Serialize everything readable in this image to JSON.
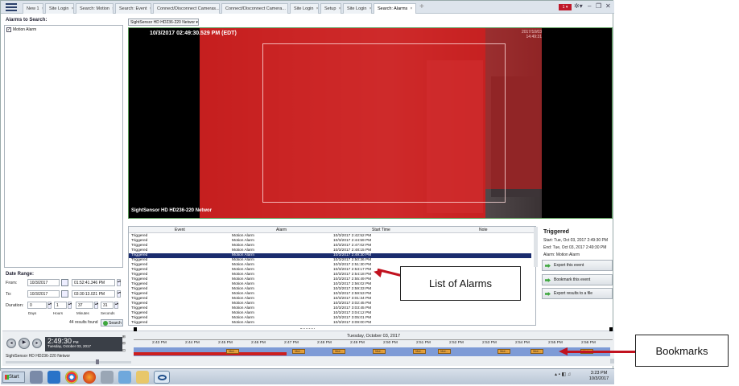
{
  "app": {
    "tabs": [
      "New 1",
      "Site Login",
      "Search: Motion",
      "Search: Event",
      "Connect/Disconnect Cameras...",
      "Connect/Disconnect Camera...",
      "Site Login",
      "Setup",
      "Site Login",
      "Search: Alarms"
    ],
    "active_tab": "Search: Alarms",
    "badge": "1"
  },
  "left": {
    "alarms_title": "Alarms to Search:",
    "alarm_item": "Motion Alarm",
    "date_range_title": "Date Range:",
    "from_label": "From:",
    "from_date": "10/3/2017",
    "from_time": "01:52:41.346 PM",
    "to_label": "To:",
    "to_date": "10/3/2017",
    "to_time": "03:30:13.021 PM",
    "duration_label": "Duration:",
    "dur_days": "0",
    "dur_hours": "1",
    "dur_minutes": "37",
    "dur_seconds": "31",
    "days": "Days",
    "hours": "Hours",
    "minutes": "Minutes",
    "seconds": "Seconds",
    "results": "44 results found",
    "search": "Search"
  },
  "camera": {
    "selector": "SightSensor HD HD236-220 Networ",
    "overlay_datetime": "10/3/2017 02:49:30.529 PM (EDT)",
    "corner_text": "2017/10/03 14:49:31",
    "name_overlay": "SightSensor HD HD236-220 Networ"
  },
  "list": {
    "headers": [
      "Event",
      "Alarm",
      "Start Time",
      "Note"
    ],
    "rows": [
      [
        "Triggered",
        "Motion Alarm",
        "10/3/2017 2:42:52 PM"
      ],
      [
        "Triggered",
        "Motion Alarm",
        "10/3/2017 2:44:59 PM"
      ],
      [
        "Triggered",
        "Motion Alarm",
        "10/3/2017 2:47:02 PM"
      ],
      [
        "Triggered",
        "Motion Alarm",
        "10/3/2017 2:48:15 PM"
      ],
      [
        "Triggered",
        "Motion Alarm",
        "10/3/2017 2:49:30 PM"
      ],
      [
        "Triggered",
        "Motion Alarm",
        "10/3/2017 2:50:36 PM"
      ],
      [
        "Triggered",
        "Motion Alarm",
        "10/3/2017 2:51:30 PM"
      ],
      [
        "Triggered",
        "Motion Alarm",
        "10/3/2017 2:53:17 PM"
      ],
      [
        "Triggered",
        "Motion Alarm",
        "10/3/2017 2:54:18 PM"
      ],
      [
        "Triggered",
        "Motion Alarm",
        "10/3/2017 2:55:49 PM"
      ],
      [
        "Triggered",
        "Motion Alarm",
        "10/3/2017 2:56:02 PM"
      ],
      [
        "Triggered",
        "Motion Alarm",
        "10/3/2017 2:59:33 PM"
      ],
      [
        "Triggered",
        "Motion Alarm",
        "10/3/2017 2:59:53 PM"
      ],
      [
        "Triggered",
        "Motion Alarm",
        "10/3/2017 3:01:34 PM"
      ],
      [
        "Triggered",
        "Motion Alarm",
        "10/3/2017 3:02:45 PM"
      ],
      [
        "Triggered",
        "Motion Alarm",
        "10/3/2017 3:03:45 PM"
      ],
      [
        "Triggered",
        "Motion Alarm",
        "10/3/2017 3:04:12 PM"
      ],
      [
        "Triggered",
        "Motion Alarm",
        "10/3/2017 3:05:01 PM"
      ],
      [
        "Triggered",
        "Motion Alarm",
        "10/3/2017 3:09:00 PM"
      ]
    ],
    "selected_index": 4
  },
  "details": {
    "title": "Triggered",
    "start": "Start:  Tue, Oct 03, 2017 2:49:30 PM",
    "end": "End:   Tue, Oct 03, 2017 2:49:30 PM",
    "alarm": "Alarm: Motion Alarm",
    "export_event": "Export this event",
    "bookmark": "Bookmark this event",
    "export_results": "Export results to a file"
  },
  "callouts": {
    "list": "List of Alarms",
    "bookmarks": "Bookmarks"
  },
  "player": {
    "time": "2:49:30",
    "ampm": "PM",
    "date": "Tuesday, October 03, 2017",
    "camera": "SightSensor HD HD236-220 Networ"
  },
  "timeline": {
    "date": "Tuesday, October 03, 2017",
    "ticks": [
      "2:43 PM",
      "2:44 PM",
      "2:45 PM",
      "2:46 PM",
      "2:47 PM",
      "2:48 PM",
      "2:49 PM",
      "2:50 PM",
      "2:51 PM",
      "2:52 PM",
      "2:53 PM",
      "2:54 PM",
      "2:55 PM",
      "2:56 PM"
    ],
    "bookmark_label": "Mot..."
  },
  "taskbar": {
    "start": "Start",
    "time": "3:23 PM",
    "date": "10/3/2017"
  }
}
